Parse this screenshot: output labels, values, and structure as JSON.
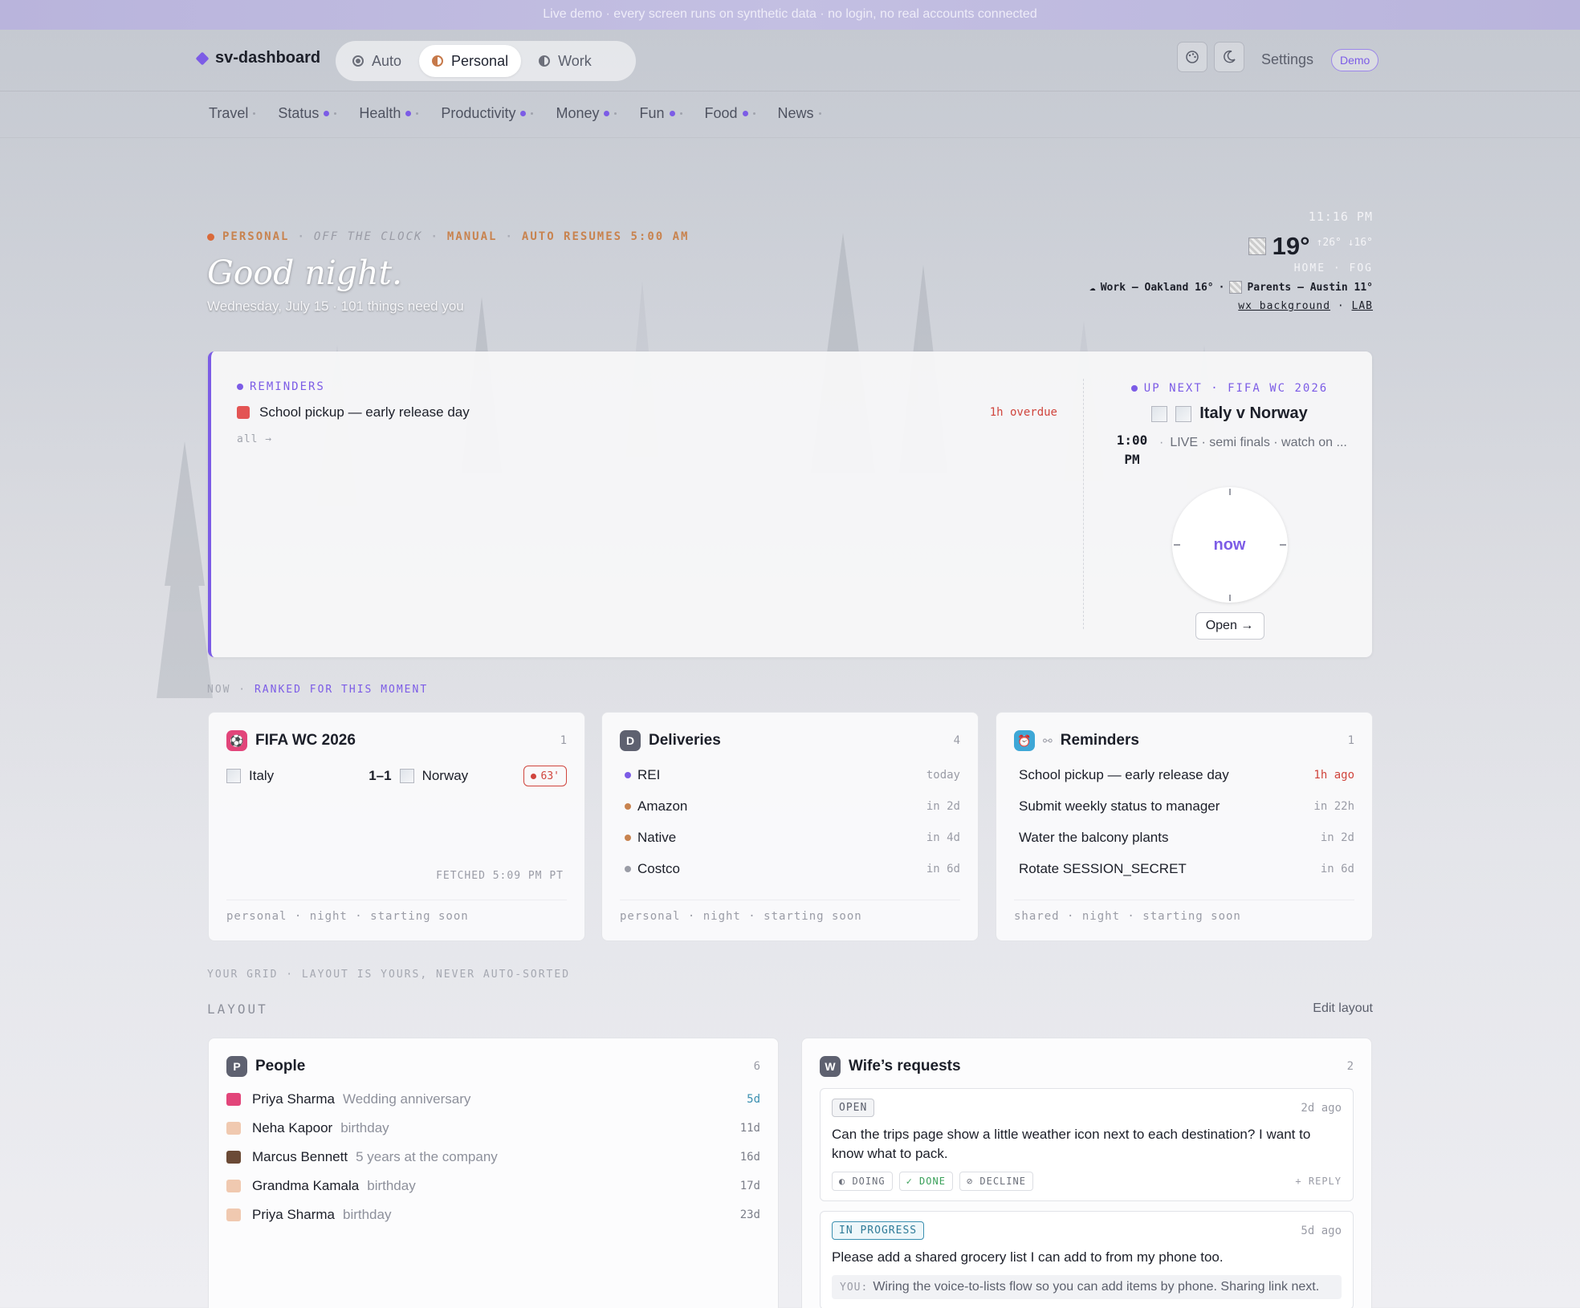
{
  "banner": "Live demo · every screen runs on synthetic data · no login, no real accounts connected",
  "brand": "sv-dashboard",
  "modes": [
    {
      "label": "Auto",
      "active": false
    },
    {
      "label": "Personal",
      "active": true
    },
    {
      "label": "Work",
      "active": false
    }
  ],
  "header": {
    "theme_icon": "palette-icon",
    "darkmode_icon": "moon-icon",
    "settings_label": "Settings",
    "demo_badge": "Demo"
  },
  "nav": [
    "Travel",
    "Status",
    "Health",
    "Productivity",
    "Money",
    "Fun",
    "Food",
    "News"
  ],
  "hero": {
    "context_mode": "PERSONAL",
    "context_state": "OFF THE CLOCK",
    "context_manual": "MANUAL",
    "context_resume": "AUTO RESUMES 5:00 AM",
    "greeting": "Good night.",
    "subline": "Wednesday, July 15 · 101 things need you"
  },
  "weather": {
    "time": "11:16 PM",
    "temp": "19°",
    "hilo": "↑26° ↓16°",
    "location": "HOME · FOG",
    "work": "Work — Oakland 16°",
    "parents": "Parents — Austin 11°",
    "link_bg": "wx background",
    "link_lab": "LAB"
  },
  "top_card": {
    "reminders_label": "REMINDERS",
    "reminder_item": "School pickup — early release day",
    "reminder_status": "1h overdue",
    "all_link": "all →",
    "upnext_label": "UP NEXT · FIFA WC 2026",
    "match": "Italy v Norway",
    "match_time": "1:00 PM",
    "match_desc": "LIVE · semi finals · watch on ...",
    "clock_text": "now",
    "open_btn": "Open →"
  },
  "now_caption": {
    "prefix": "NOW · ",
    "highlight": "RANKED FOR THIS MOMENT"
  },
  "fifa_card": {
    "title": "FIFA WC 2026",
    "count": "1",
    "home": "Italy",
    "score": "1–1",
    "away": "Norway",
    "minute": "63'",
    "fetched": "FETCHED 5:09 PM PT",
    "footer": "personal · night · starting soon"
  },
  "deliveries_card": {
    "title": "Deliveries",
    "icon_letter": "D",
    "count": "4",
    "items": [
      {
        "name": "REI",
        "when": "today",
        "color": "#7c5ce6"
      },
      {
        "name": "Amazon",
        "when": "in 2d",
        "color": "#c8834f"
      },
      {
        "name": "Native",
        "when": "in 4d",
        "color": "#c8834f"
      },
      {
        "name": "Costco",
        "when": "in 6d",
        "color": "#9a9ca6"
      }
    ],
    "footer": "personal · night · starting soon"
  },
  "reminders_card": {
    "title": "Reminders",
    "count": "1",
    "items": [
      {
        "name": "School pickup — early release day",
        "when": "1h ago"
      },
      {
        "name": "Submit weekly status to manager",
        "when": "in 22h"
      },
      {
        "name": "Water the balcony plants",
        "when": "in 2d"
      },
      {
        "name": "Rotate SESSION_SECRET",
        "when": "in 6d"
      }
    ],
    "footer": "shared · night · starting soon"
  },
  "grid_caption": "YOUR GRID · LAYOUT IS YOURS, NEVER AUTO-SORTED",
  "layout": {
    "label": "LAYOUT",
    "edit": "Edit layout"
  },
  "people_card": {
    "title": "People",
    "icon_letter": "P",
    "count": "6",
    "items": [
      {
        "name": "Priya Sharma",
        "note": "Wedding anniversary",
        "days": "5d",
        "icon": "heart-icon"
      },
      {
        "name": "Neha Kapoor",
        "note": "birthday",
        "days": "11d",
        "icon": "cake-icon"
      },
      {
        "name": "Marcus Bennett",
        "note": "5 years at the company",
        "days": "16d",
        "icon": "briefcase-icon"
      },
      {
        "name": "Grandma Kamala",
        "note": "birthday",
        "days": "17d",
        "icon": "cake-icon"
      },
      {
        "name": "Priya Sharma",
        "note": "birthday",
        "days": "23d",
        "icon": "cake-icon"
      }
    ]
  },
  "wife_card": {
    "title": "Wife’s requests",
    "icon_letter": "W",
    "count": "2",
    "requests": [
      {
        "status": "OPEN",
        "ago": "2d ago",
        "text": "Can the trips page show a little weather icon next to each destination? I want to know what to pack.",
        "actions": [
          "◐ DOING",
          "✓ DONE",
          "⊘ DECLINE"
        ],
        "reply": "+ REPLY"
      },
      {
        "status": "IN PROGRESS",
        "ago": "5d ago",
        "text": "Please add a shared grocery list I can add to from my phone too.",
        "you_label": "YOU:",
        "you_text": "Wiring the voice-to-lists flow so you can add items by phone. Sharing link next."
      }
    ]
  }
}
